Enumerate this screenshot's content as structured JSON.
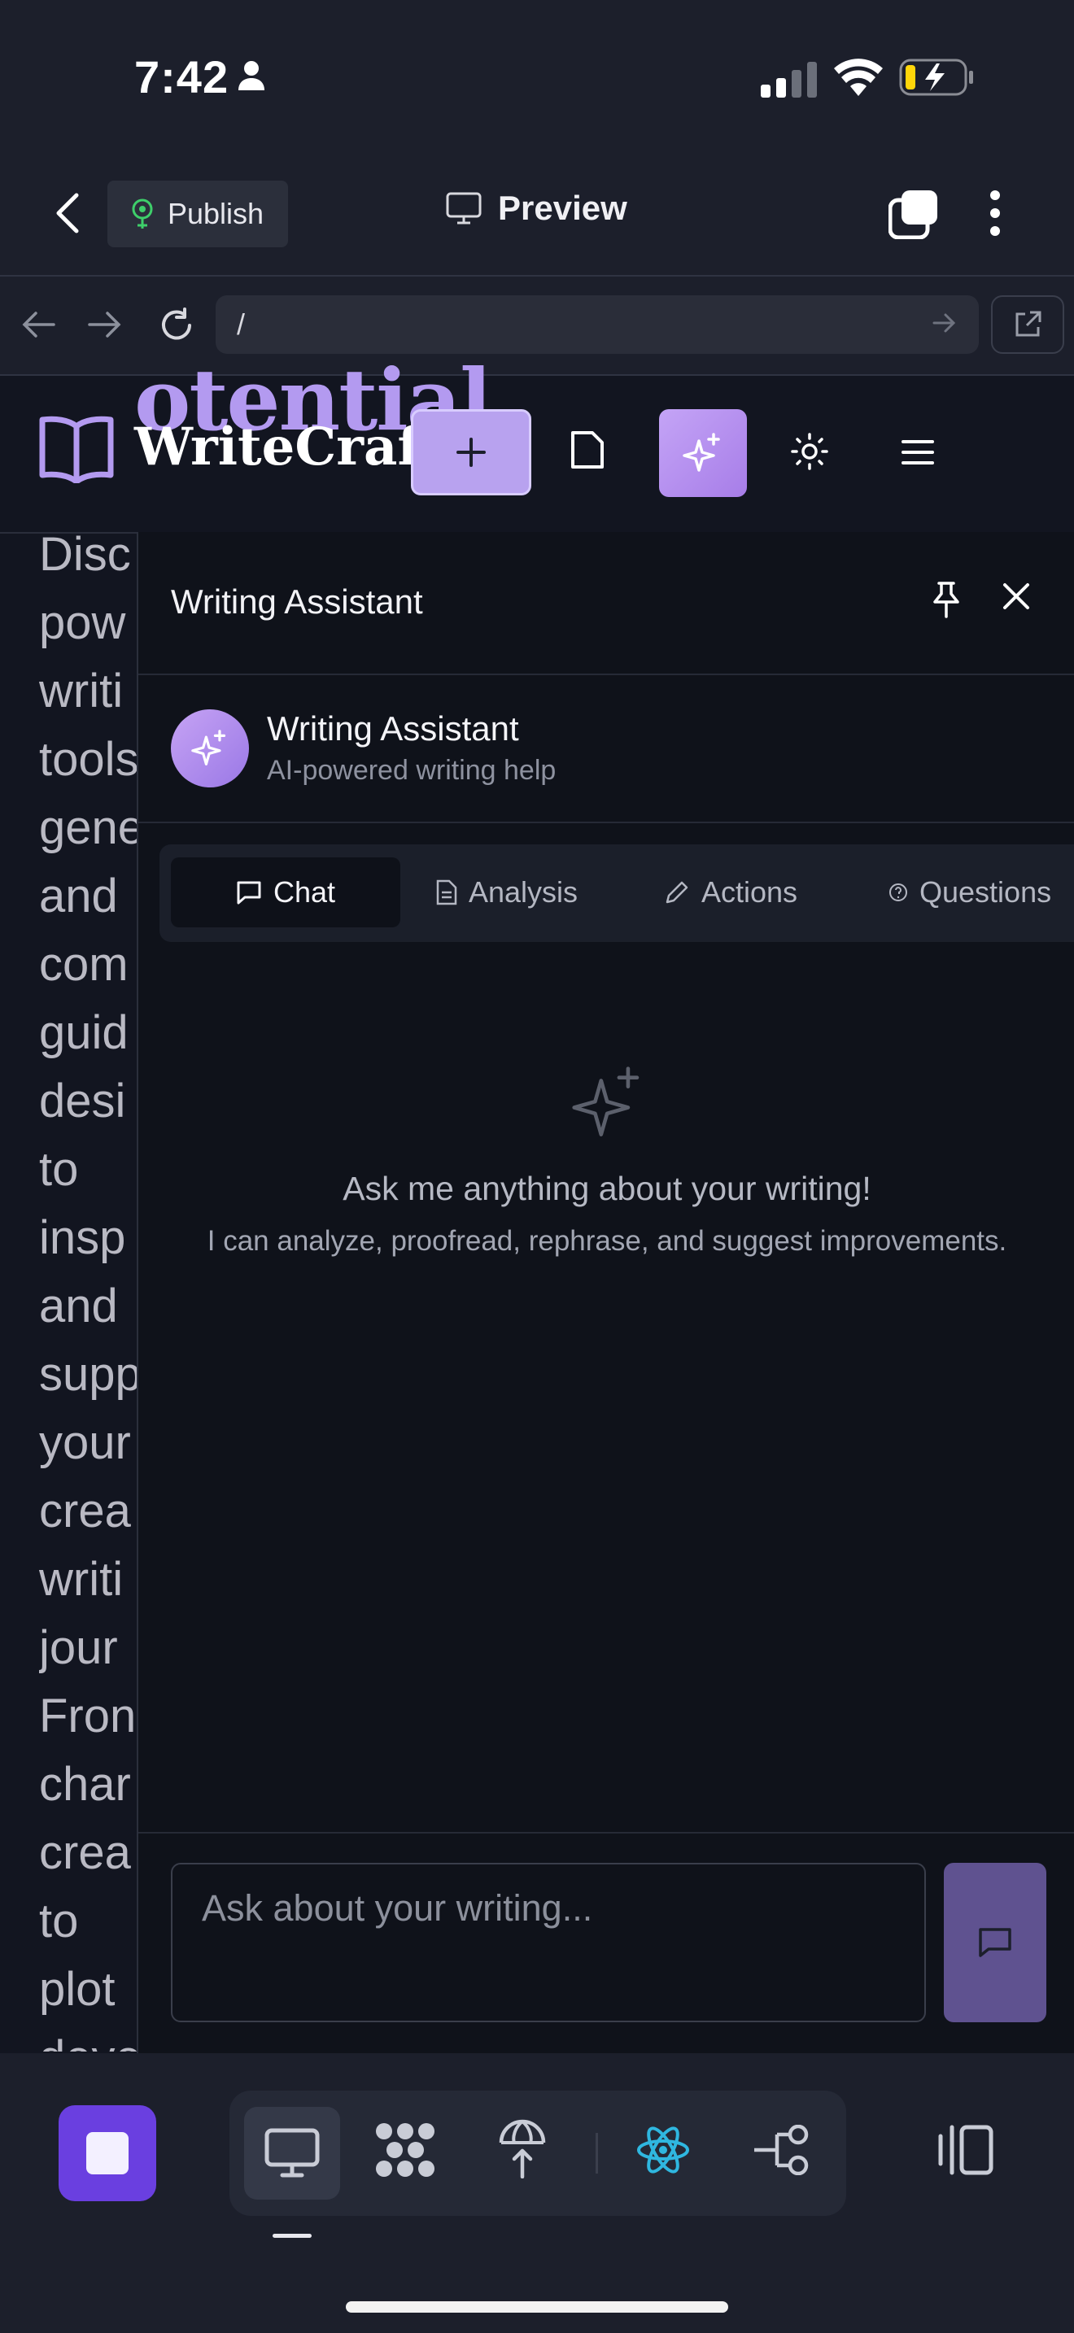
{
  "status_bar": {
    "time": "7:42"
  },
  "toolbar": {
    "publish_label": "Publish",
    "preview_label": "Preview"
  },
  "browser": {
    "url": "/"
  },
  "site": {
    "hero_fragment": "otential",
    "brand_name": "WriteCraft",
    "article_lines": [
      "Disc",
      "pow",
      "writi",
      "tools",
      "gene",
      "and",
      "com",
      "guid",
      "desi",
      "to",
      "insp",
      "and",
      "supp",
      "your",
      "crea",
      "writi",
      "jour",
      "Fron",
      "char",
      "crea",
      "to",
      "plot",
      "deve"
    ]
  },
  "assistant": {
    "panel_title": "Writing Assistant",
    "name": "Writing Assistant",
    "subtitle": "AI-powered writing help",
    "tabs": [
      {
        "label": "Chat",
        "icon": "chat-icon",
        "active": true
      },
      {
        "label": "Analysis",
        "icon": "document-icon",
        "active": false
      },
      {
        "label": "Actions",
        "icon": "pencil-icon",
        "active": false
      },
      {
        "label": "Questions",
        "icon": "help-circle-icon",
        "active": false
      }
    ],
    "empty_title": "Ask me anything about your writing!",
    "empty_subtitle": "I can analyze, proofread, rephrase, and suggest improvements.",
    "input_placeholder": "Ask about your writing..."
  },
  "colors": {
    "accent": "#b8a2ef",
    "stop_button": "#6a3fe0",
    "send_button": "#5f5290",
    "react_icon": "#2fb7e0",
    "publish_icon": "#3ecf6a"
  }
}
